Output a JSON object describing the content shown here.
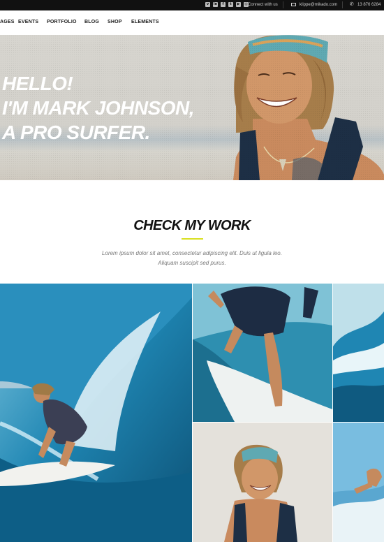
{
  "topbar": {
    "social_icons": [
      "vimeo-icon",
      "linkedin-icon",
      "facebook-icon",
      "twitter-icon",
      "youtube-icon",
      "instagram-icon"
    ],
    "connect_label": "Connect with us",
    "email": "klippe@mikado.com",
    "phone": "13 876 6284"
  },
  "nav": {
    "items": [
      "AGES",
      "EVENTS",
      "PORTFOLIO",
      "BLOG",
      "SHOP",
      "ELEMENTS"
    ]
  },
  "hero": {
    "line1": "HELLO!",
    "line2": "I'M MARK JOHNSON,",
    "line3": "A PRO SURFER."
  },
  "work": {
    "title": "CHECK MY WORK",
    "desc_line1": "Lorem ipsum dolor sit amet, consectetur adipiscing elit. Duis ut ligula leo.",
    "desc_line2": "Aliquam suscipit sed purus."
  },
  "colors": {
    "accent": "#d9e021",
    "topbar": "#111111",
    "ocean": "#2e8fb8"
  }
}
